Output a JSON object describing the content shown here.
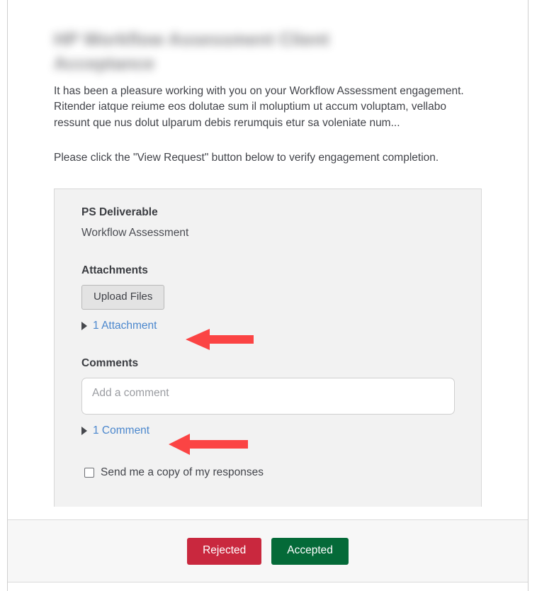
{
  "email": {
    "heading_redacted": "HP Workflow Assessment Client Acceptance",
    "paragraphs": [
      "It has been a pleasure working with you on your Workflow Assessment engagement. Ritender iatque reiume eos dolutae sum il moluptium ut accum voluptam, vellabo ressunt que nus dolut ulparum debis rerumquis etur sa voleniate num...",
      "Please click the \"View Request\" button below to verify engagement completion."
    ]
  },
  "card": {
    "deliverable_label": "PS Deliverable",
    "deliverable_value": "Workflow Assessment",
    "attachments": {
      "title": "Attachments",
      "upload_button": "Upload Files",
      "disclosure_label": "1 Attachment",
      "disclosure_icon": "triangle-right-icon"
    },
    "comments": {
      "title": "Comments",
      "input_value": "",
      "input_placeholder": "Add a comment",
      "disclosure_label": "1 Comment",
      "disclosure_icon": "triangle-right-icon"
    },
    "copy_checkbox": {
      "label": "Send me a copy of my responses",
      "checked": false
    }
  },
  "footer": {
    "reject_label": "Rejected",
    "accept_label": "Accepted"
  },
  "annotations": {
    "arrow_1": "arrow-left-icon",
    "arrow_2": "arrow-left-icon"
  },
  "colors": {
    "reject": "#c9283e",
    "accept": "#046a38",
    "link": "#4b87cd",
    "arrow": "#fb4444",
    "card_bg": "#f2f2f2",
    "footer_bg": "#f7f7f7"
  }
}
